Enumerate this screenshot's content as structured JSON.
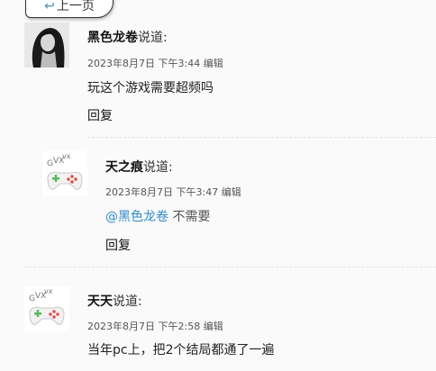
{
  "nav": {
    "prev_label": "上一页",
    "prev_icon": "return-arrow-icon"
  },
  "comments": [
    {
      "author": "黑色龙卷",
      "said": "说道:",
      "date": "2023年8月7日 下午3:44",
      "edit": "编辑",
      "text": "玩这个游戏需要超频吗",
      "reply": "回复"
    },
    {
      "author": "天之痕",
      "said": "说道:",
      "date": "2023年8月7日 下午3:47",
      "edit": "编辑",
      "mention": "@黑色龙卷",
      "text": " 不需要",
      "reply": "回复"
    },
    {
      "author": "天天",
      "said": "说道:",
      "date": "2023年8月7日 下午2:58",
      "edit": "编辑",
      "text": "当年pc上，把2个结局都通了一遍"
    }
  ],
  "colors": {
    "mention": "#2e8bc9",
    "gamepad_green": "#5cb85c",
    "gamepad_red": "#e05050"
  }
}
